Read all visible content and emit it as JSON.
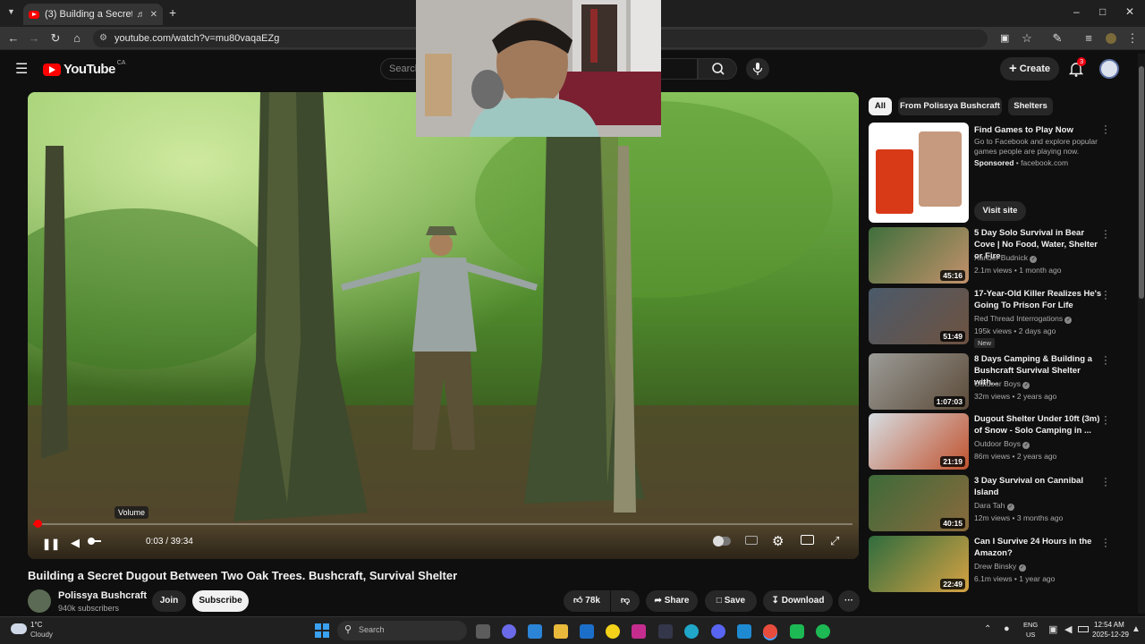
{
  "browser": {
    "tab_title": "(3) Building a Secret Dugou",
    "url": "youtube.com/watch?v=mu80vaqaEZg"
  },
  "header": {
    "logo_text": "YouTube",
    "region": "CA",
    "search_placeholder": "Search",
    "create_label": "Create",
    "notifications_count": "3"
  },
  "player": {
    "time": "0:03 / 39:34",
    "tooltip": "Volume",
    "progress_fraction": 0.0013
  },
  "video": {
    "title": "Building a Secret Dugout Between Two Oak Trees. Bushcraft, Survival Shelter",
    "channel": "Polissya Bushcraft",
    "subscribers": "940k subscribers",
    "join_label": "Join",
    "subscribe_label": "Subscribe",
    "likes": "78k",
    "share_label": "Share",
    "save_label": "Save",
    "download_label": "Download"
  },
  "sidebar": {
    "chips": [
      "All",
      "From Polissya Bushcraft",
      "Shelters"
    ],
    "ad": {
      "title": "Find Games to Play Now",
      "desc": "Go to Facebook and explore popular games people are playing now.",
      "sponsored": "Sponsored",
      "domain": "facebook.com",
      "cta": "Visit site"
    },
    "recs": [
      {
        "title": "5 Day Solo Survival in Bear Cove | No Food, Water, Shelter or Fire",
        "channel": "Xander Budnick",
        "meta": "2.1m views • 1 month ago",
        "duration": "45:16",
        "badge": ""
      },
      {
        "title": "17-Year-Old Killer Realizes He's Going To Prison For Life",
        "channel": "Red Thread Interrogations",
        "meta": "195k views • 2 days ago",
        "duration": "51:49",
        "badge": "New"
      },
      {
        "title": "8 Days Camping & Building a Bushcraft Survival Shelter with...",
        "channel": "Outdoor Boys",
        "meta": "32m views • 2 years ago",
        "duration": "1:07:03",
        "badge": ""
      },
      {
        "title": "Dugout Shelter Under 10ft (3m) of Snow - Solo Camping in ...",
        "channel": "Outdoor Boys",
        "meta": "86m views • 2 years ago",
        "duration": "21:19",
        "badge": ""
      },
      {
        "title": "3 Day Survival on Cannibal Island",
        "channel": "Dara Tah",
        "meta": "12m views • 3 months ago",
        "duration": "40:15",
        "badge": ""
      },
      {
        "title": "Can I Survive 24 Hours in the Amazon?",
        "channel": "Drew Binsky",
        "meta": "6.1m views • 1 year ago",
        "duration": "22:49",
        "badge": ""
      }
    ]
  },
  "taskbar": {
    "weather_temp": "1°C",
    "weather_desc": "Cloudy",
    "search_label": "Search",
    "lang": "ENG",
    "lang_region": "US",
    "time": "12:54 AM",
    "date": "2025-12-29"
  },
  "colors": {
    "brand_red": "#ff0000",
    "bg": "#0f0f0f"
  }
}
